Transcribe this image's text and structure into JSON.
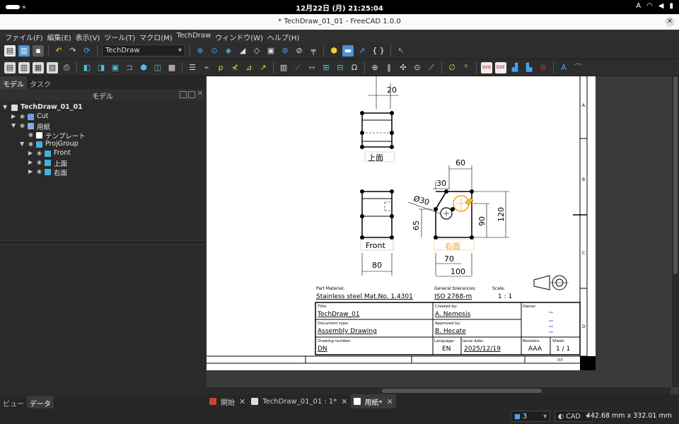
{
  "system_bar": {
    "clock": "12月22日 (月)  21:25:04",
    "input_method": "A"
  },
  "window": {
    "title": "* TechDraw_01_01 - FreeCAD 1.0.0"
  },
  "menu": [
    "ファイル(F)",
    "編集(E)",
    "表示(V)",
    "ツール(T)",
    "マクロ(M)",
    "TechDraw",
    "ウィンドウ(W)",
    "ヘルプ(H)"
  ],
  "toolbar": {
    "workbench": "TechDraw",
    "braces": "{ }"
  },
  "left_panel": {
    "tabs": [
      "モデル",
      "タスク"
    ],
    "header": "モデル",
    "tree": [
      {
        "label": "TechDraw_01_01",
        "level": 0,
        "expanded": true,
        "icon": "document-icon",
        "color": "#dddddd"
      },
      {
        "label": "Cut",
        "level": 1,
        "expanded": false,
        "icon": "cut-icon",
        "color": "#6aa0e8"
      },
      {
        "label": "用紙",
        "level": 1,
        "expanded": true,
        "icon": "page-icon",
        "color": "#7fb0e0"
      },
      {
        "label": "テンプレート",
        "level": 2,
        "expanded": null,
        "icon": "template-icon",
        "color": "#ffffff"
      },
      {
        "label": "ProjGroup",
        "level": 2,
        "expanded": true,
        "icon": "projgroup-icon",
        "color": "#3fb4d8"
      },
      {
        "label": "Front",
        "level": 3,
        "expanded": false,
        "icon": "view-icon",
        "color": "#3fb4d8"
      },
      {
        "label": "上面",
        "level": 3,
        "expanded": false,
        "icon": "view-icon",
        "color": "#3fb4d8"
      },
      {
        "label": "右面",
        "level": 3,
        "expanded": false,
        "icon": "view-icon",
        "color": "#3fb4d8"
      }
    ],
    "bottom_tabs": [
      "ビュー",
      "データ"
    ]
  },
  "drawing": {
    "views": {
      "top": "上面",
      "front": "Front",
      "right": "右面"
    },
    "dimensions": {
      "top_width": "20",
      "front_width": "80",
      "right_60": "60",
      "right_30": "30",
      "diameter": "Ø30",
      "right_65": "65",
      "right_90": "90",
      "right_120": "120",
      "right_70": "70",
      "right_100": "100"
    },
    "title_block": {
      "part_material_label": "Part Material:",
      "part_material": "Stainless steel Mat.No. 1.4301",
      "tolerances_label": "General tolerances:",
      "tolerances": "ISO 2768-m",
      "scale_label": "Scale:",
      "scale": "1 : 1",
      "title_label": "Title:",
      "title": "TechDraw_01",
      "created_label": "Created by:",
      "created_by": "A. Nemesis",
      "owner_label": "Owner:",
      "doctype_label": "Document type:",
      "doctype": "Assembly Drawing",
      "approved_label": "Approved by:",
      "approved_by": "B. Hecate",
      "drawing_number_label": "Drawing number:",
      "drawing_number": "DN",
      "language_label": "Language:",
      "language": "EN",
      "issue_date_label": "Issue date:",
      "issue_date": "2025/12/19",
      "revision_label": "Revision:",
      "revision": "AAA",
      "sheet_label": "Sheet:",
      "sheet": "1 / 1",
      "size": "A4"
    },
    "zones": [
      "A",
      "B",
      "C",
      "D"
    ]
  },
  "doc_tabs": [
    {
      "label": "開始",
      "active": false
    },
    {
      "label": "TechDraw_01_01 : 1*",
      "active": false
    },
    {
      "label": "用紙*",
      "active": true
    }
  ],
  "status": {
    "count": "3",
    "nav": "CAD",
    "dimensions": "442.68 mm x 332.01 mm"
  }
}
